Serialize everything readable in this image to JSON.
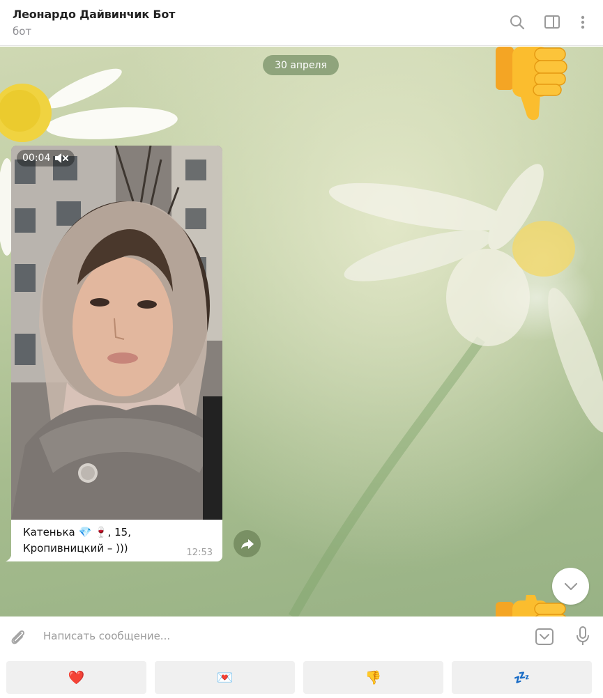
{
  "header": {
    "title": "Леонардо Дайвинчик Бот",
    "subtitle": "бот"
  },
  "chat": {
    "date_label": "30 апреля",
    "message": {
      "video_duration": "00:04",
      "caption_line1": "Катенька 💎 🍷, 15,",
      "caption_line2": "Кропивницкий – )))",
      "time": "12:53"
    }
  },
  "composer": {
    "placeholder": "Написать сообщение..."
  },
  "keyboard": {
    "buttons": [
      "❤️",
      "💌",
      "👎",
      "💤"
    ]
  },
  "colors": {
    "accent": "#8fa47c",
    "thumb": "#f7b52b"
  },
  "icons": [
    "search-icon",
    "sidebar-toggle-icon",
    "more-vertical-icon",
    "mute-icon",
    "share-icon",
    "chevron-down-icon",
    "paperclip-icon",
    "keyboard-toggle-icon",
    "microphone-icon",
    "thumbs-down-emoji"
  ]
}
